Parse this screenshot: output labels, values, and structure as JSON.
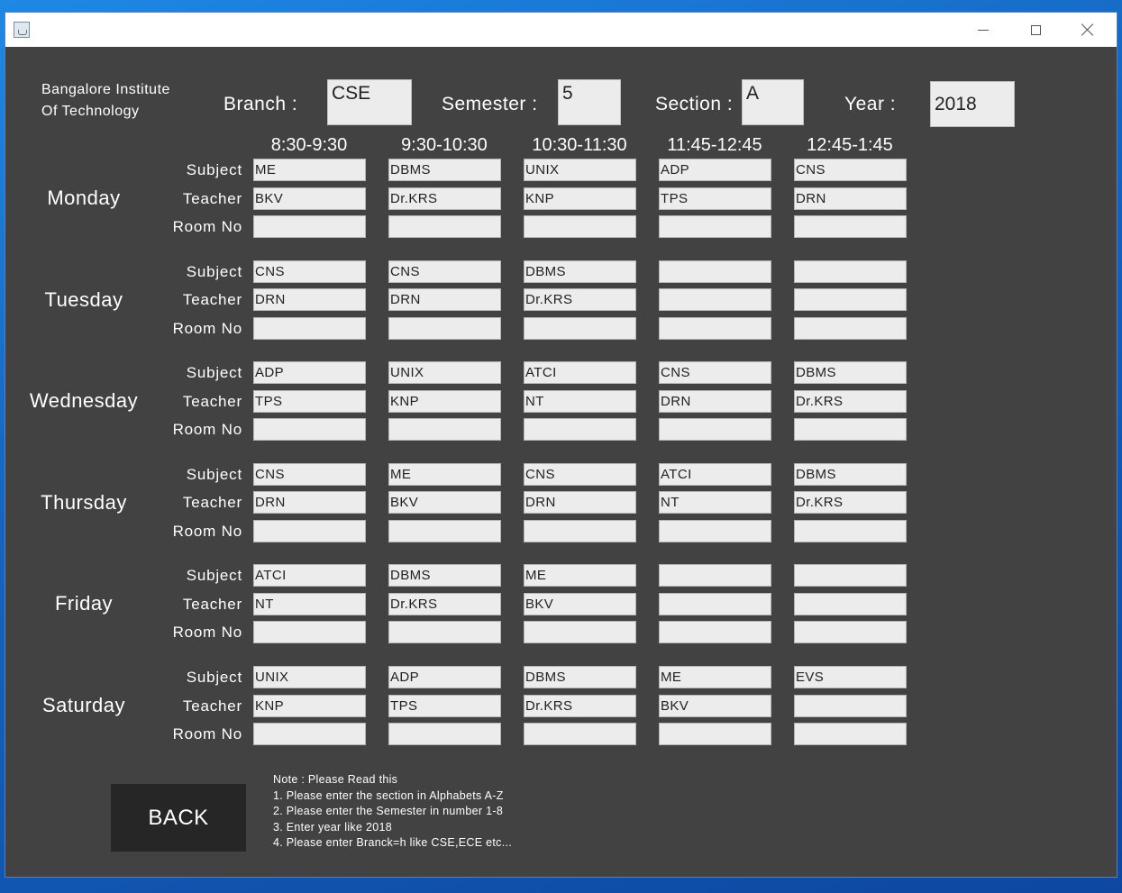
{
  "window": {
    "title": ""
  },
  "institute": "Bangalore Institute\nOf Technology",
  "header": {
    "branch_label": "Branch :",
    "branch_value": "CSE",
    "semester_label": "Semester :",
    "semester_value": "5",
    "section_label": "Section :",
    "section_value": "A",
    "year_label": "Year :",
    "year_value": "2018"
  },
  "slots": [
    "8:30-9:30",
    "9:30-10:30",
    "10:30-11:30",
    "11:45-12:45",
    "12:45-1:45"
  ],
  "row_labels": {
    "subject": "Subject",
    "teacher": "Teacher",
    "room": "Room No"
  },
  "days": [
    {
      "name": "Monday",
      "subject": [
        "ME",
        "DBMS",
        "UNIX",
        "ADP",
        "CNS"
      ],
      "teacher": [
        "BKV",
        "Dr.KRS",
        "KNP",
        "TPS",
        "DRN"
      ],
      "room": [
        "",
        "",
        "",
        "",
        ""
      ]
    },
    {
      "name": "Tuesday",
      "subject": [
        "CNS",
        "CNS",
        "DBMS",
        "",
        ""
      ],
      "teacher": [
        "DRN",
        "DRN",
        "Dr.KRS",
        "",
        ""
      ],
      "room": [
        "",
        "",
        "",
        "",
        ""
      ]
    },
    {
      "name": "Wednesday",
      "subject": [
        "ADP",
        "UNIX",
        "ATCI",
        "CNS",
        "DBMS"
      ],
      "teacher": [
        "TPS",
        "KNP",
        "NT",
        "DRN",
        "Dr.KRS"
      ],
      "room": [
        "",
        "",
        "",
        "",
        ""
      ]
    },
    {
      "name": "Thursday",
      "subject": [
        "CNS",
        "ME",
        "CNS",
        "ATCI",
        "DBMS"
      ],
      "teacher": [
        "DRN",
        "BKV",
        "DRN",
        "NT",
        "Dr.KRS"
      ],
      "room": [
        "",
        "",
        "",
        "",
        ""
      ]
    },
    {
      "name": "Friday",
      "subject": [
        "ATCI",
        "DBMS",
        "ME",
        "",
        ""
      ],
      "teacher": [
        "NT",
        "Dr.KRS",
        "BKV",
        "",
        ""
      ],
      "room": [
        "",
        "",
        "",
        "",
        ""
      ]
    },
    {
      "name": "Saturday",
      "subject": [
        "UNIX",
        "ADP",
        "DBMS",
        "ME",
        "EVS"
      ],
      "teacher": [
        "KNP",
        "TPS",
        "Dr.KRS",
        "BKV",
        ""
      ],
      "room": [
        "",
        "",
        "",
        "",
        ""
      ]
    }
  ],
  "back_label": "BACK",
  "note": [
    "Note : Please Read this",
    "1. Please enter the section in Alphabets A-Z",
    "2. Please enter the Semester in number 1-8",
    "3. Enter year like 2018",
    "4. Please enter Branck=h like CSE,ECE etc..."
  ]
}
